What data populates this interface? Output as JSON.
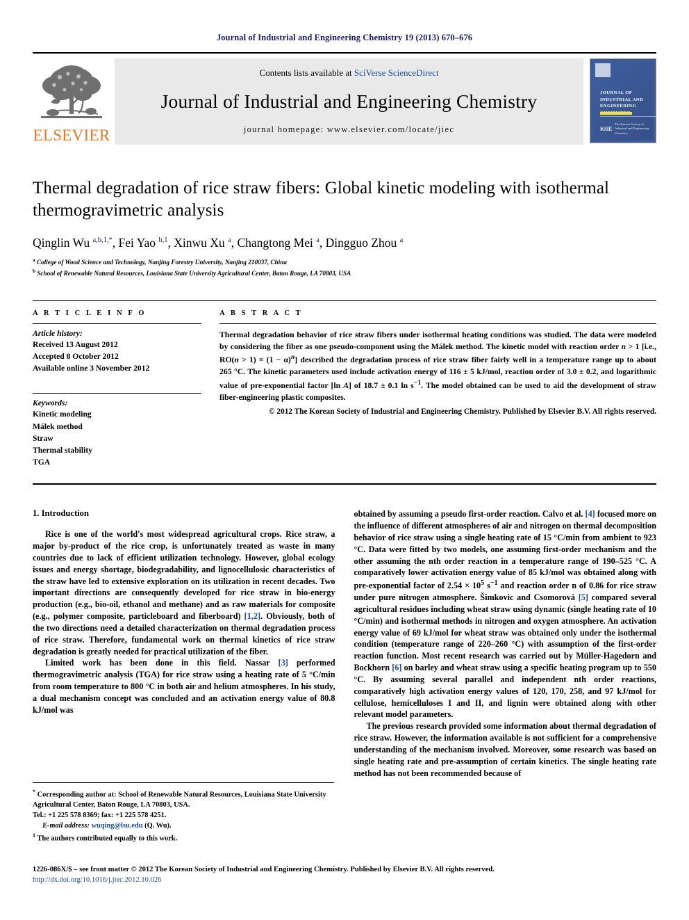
{
  "running_head": "Journal of Industrial and Engineering Chemistry 19 (2013) 670–676",
  "masthead": {
    "publisher_wordmark": "ELSEVIER",
    "contents_prefix": "Contents lists available at ",
    "contents_link": "SciVerse ScienceDirect",
    "journal_title": "Journal of Industrial and Engineering Chemistry",
    "homepage_line": "journal homepage: www.elsevier.com/locate/jiec",
    "cover": {
      "title_lines": "JOURNAL OF INDUSTRIAL AND ENGINEERING CHEMISTRY",
      "society_mark": "KSIE",
      "society_text": "The Korean Society of Industrial and Engineering Chemistry"
    }
  },
  "article": {
    "title": "Thermal degradation of rice straw fibers: Global kinetic modeling with isothermal thermogravimetric analysis",
    "authors_html": "Qinglin Wu <sup>a,b,1,*</sup>, Fei Yao <sup>b,1</sup>, Xinwu Xu <sup>a</sup>, Changtong Mei <sup>a</sup>, Dingguo Zhou <sup>a</sup>",
    "affiliation_a": "College of Wood Science and Technology, Nanjing Forestry University, Nanjing 210037, China",
    "affiliation_b": "School of Renewable Natural Resources, Louisiana State University Agricultural Center, Baton Rouge, LA 70803, USA"
  },
  "info": {
    "heading": "A R T I C L E   I N F O",
    "history_label": "Article history:",
    "history": [
      "Received 13 August 2012",
      "Accepted 8 October 2012",
      "Available online 3 November 2012"
    ],
    "keywords_label": "Keywords:",
    "keywords": [
      "Kinetic modeling",
      "Málek method",
      "Straw",
      "Thermal stability",
      "TGA"
    ]
  },
  "abstract": {
    "heading": "A B S T R A C T",
    "body_html": "Thermal degradation behavior of rice straw fibers under isothermal heating conditions was studied. The data were modeled by considering the fiber as one pseudo-component using the Málek method. The kinetic model with reaction order <i>n</i> &gt; 1 [i.e., RO(<i>n</i> &gt; 1) = (1 &minus; &alpha;)<sup><i>n</i></sup>] described the degradation process of rice straw fiber fairly well in a temperature range up to about 265&nbsp;&deg;C. The kinetic parameters used include activation energy of 116 &plusmn; 5 kJ/mol, reaction order of 3.0 &plusmn; 0.2, and logarithmic value of pre-exponential factor [ln <i>A</i>] of 18.7 &plusmn; 0.1 ln s<sup>&minus;1</sup>. The model obtained can be used to aid the development of straw fiber-engineering plastic composites.",
    "copyright": "© 2012 The Korean Society of Industrial and Engineering Chemistry. Published by Elsevier B.V. All rights reserved."
  },
  "main": {
    "section_heading": "1. Introduction",
    "left_paragraphs_html": [
      "Rice is one of the world's most widespread agricultural crops. Rice straw, a major by-product of the rice crop, is unfortunately treated as waste in many countries due to lack of efficient utilization technology. However, global ecology issues and energy shortage, biodegradability, and lignocellulosic characteristics of the straw have led to extensive exploration on its utilization in recent decades. Two important directions are consequently developed for rice straw in bio-energy production (e.g., bio-oil, ethanol and methane) and as raw materials for composite (e.g., polymer composite, particleboard and fiberboard) <span class=\"ref\">[1,2]</span>. Obviously, both of the two directions need a detailed characterization on thermal degradation process of rice straw. Therefore, fundamental work on thermal kinetics of rice straw degradation is greatly needed for practical utilization of the fiber.",
      "Limited work has been done in this field. Nassar <span class=\"ref\">[3]</span> performed thermogravimetric analysis (TGA) for rice straw using a heating rate of 5 °C/min from room temperature to 800 °C in both air and helium atmospheres. In his study, a dual mechanism concept was concluded and an activation energy value of 80.8 kJ/mol was"
    ],
    "right_paragraphs_html": [
      "obtained by assuming a pseudo first-order reaction. Calvo et al. <span class=\"ref\">[4]</span> focused more on the influence of different atmospheres of air and nitrogen on thermal decomposition behavior of rice straw using a single heating rate of 15 °C/min from ambient to 923 °C. Data were fitted by two models, one assuming first-order mechanism and the other assuming the nth order reaction in a temperature range of 190–525 °C. A comparatively lower activation energy value of 85 kJ/mol was obtained along with pre-exponential factor of 2.54 × 10<sup>5</sup> s<sup>−1</sup> and reaction order n of 0.86 for rice straw under pure nitrogen atmosphere. Šimkovic and Csomorová <span class=\"ref\">[5]</span> compared several agricultural residues including wheat straw using dynamic (single heating rate of 10 °C/min) and isothermal methods in nitrogen and oxygen atmosphere. An activation energy value of 69 kJ/mol for wheat straw was obtained only under the isothermal condition (temperature range of 220–260 °C) with assumption of the first-order reaction function. Most recent research was carried out by Müller-Hagedorn and Bockhorn <span class=\"ref\">[6]</span> on barley and wheat straw using a specific heating program up to 550 °C. By assuming several parallel and independent nth order reactions, comparatively high activation energy values of 120, 170, 258, and 97 kJ/mol for cellulose, hemicelluloses I and II, and lignin were obtained along with other relevant model parameters.",
      "The previous research provided some information about thermal degradation of rice straw. However, the information available is not sufficient for a comprehensive understanding of the mechanism involved. Moreover, some research was based on single heating rate and pre-assumption of certain kinetics. The single heating rate method has not been recommended because of"
    ]
  },
  "footnotes": {
    "corresponding_html": "<sup>*</sup> Corresponding author at: School of Renewable Natural Resources, Louisiana State University Agricultural Center, Baton Rouge, LA 70803, USA.",
    "tel_html": "Tel.: +1 225 578 8369; fax: +1 225 578 4251.",
    "email_html": "<span class=\"mail-label\">E-mail address:</span> <span class=\"mail\">wuqing@lsu.edu</span> (Q. Wu).",
    "equal_contrib_html": "<sup>1</sup> The authors contributed equally to this work."
  },
  "footer": {
    "issn_line": "1226-086X/$ – see front matter © 2012 The Korean Society of Industrial and Engineering Chemistry. Published by Elsevier B.V. All rights reserved.",
    "doi": "http://dx.doi.org/10.1016/j.jiec.2012.10.026"
  }
}
